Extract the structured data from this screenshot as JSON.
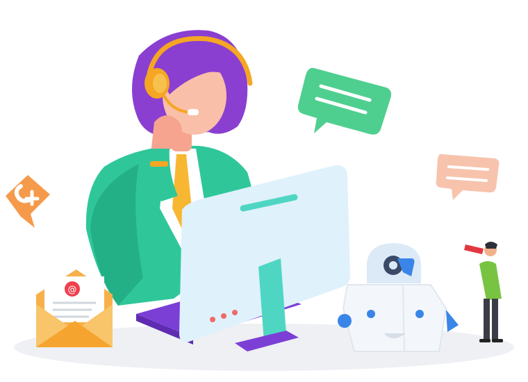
{
  "scene": {
    "description_free": true,
    "colors": {
      "hair": "#8a3fd1",
      "headset": "#f5a623",
      "jacket": "#2fc79a",
      "tie": "#f7b733",
      "skin": "#f6a48f",
      "monitor": "#dff1fb",
      "monitor_stand": "#4fd6c3",
      "keyboard": "#7c3fd6",
      "chat_green": "#4fcf8f",
      "chat_peach": "#f7c3ad",
      "chat_orange": "#f59a4a",
      "envelope": "#f7b04a",
      "robot": "#f3f7fb",
      "robot_eye": "#3a86e8",
      "ground": "#eef0f4"
    },
    "icons": [
      "support-agent-illustration",
      "chat-bubble-icon",
      "email-envelope-icon",
      "robot-icon",
      "gear-icon",
      "telescope-person-illustration"
    ]
  }
}
